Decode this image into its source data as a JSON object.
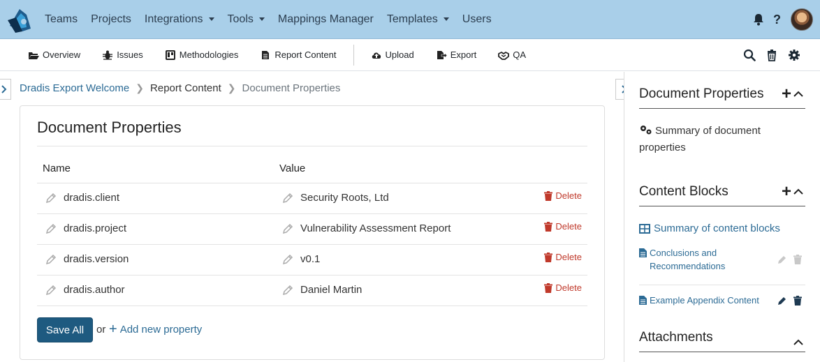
{
  "topnav": {
    "items": [
      {
        "label": "Teams",
        "dropdown": false
      },
      {
        "label": "Projects",
        "dropdown": false
      },
      {
        "label": "Integrations",
        "dropdown": true
      },
      {
        "label": "Tools",
        "dropdown": true
      },
      {
        "label": "Mappings Manager",
        "dropdown": false
      },
      {
        "label": "Templates",
        "dropdown": true
      },
      {
        "label": "Users",
        "dropdown": false
      }
    ],
    "help_label": "?"
  },
  "subnav": {
    "items": [
      {
        "label": "Overview",
        "icon": "folder-open-icon"
      },
      {
        "label": "Issues",
        "icon": "bug-icon"
      },
      {
        "label": "Methodologies",
        "icon": "board-icon"
      },
      {
        "label": "Report Content",
        "icon": "file-icon"
      },
      {
        "label": "Upload",
        "icon": "cloud-upload-icon"
      },
      {
        "label": "Export",
        "icon": "export-icon"
      },
      {
        "label": "QA",
        "icon": "handshake-icon"
      }
    ]
  },
  "breadcrumb": {
    "root": "Dradis Export Welcome",
    "middle": "Report Content",
    "current": "Document Properties"
  },
  "main": {
    "title": "Document Properties",
    "columns": {
      "name": "Name",
      "value": "Value"
    },
    "delete_label": "Delete",
    "properties": [
      {
        "name": "dradis.client",
        "value": "Security Roots, Ltd"
      },
      {
        "name": "dradis.project",
        "value": "Vulnerability Assessment Report"
      },
      {
        "name": "dradis.version",
        "value": "v0.1"
      },
      {
        "name": "dradis.author",
        "value": "Daniel Martin"
      }
    ],
    "save_label": "Save All",
    "or_label": "or",
    "add_label": "Add new property"
  },
  "sidebar": {
    "doc_props_title": "Document Properties",
    "doc_props_summary": "Summary of document properties",
    "content_blocks_title": "Content Blocks",
    "content_blocks_summary": "Summary of content blocks",
    "blocks": [
      {
        "label": "Conclusions and Recommendations",
        "active": false
      },
      {
        "label": "Example Appendix Content",
        "active": true
      }
    ],
    "attachments_title": "Attachments"
  },
  "colors": {
    "nav_bg": "#a9cfe9",
    "link": "#2c6b95",
    "primary": "#1e5a80",
    "danger": "#c0392b"
  }
}
